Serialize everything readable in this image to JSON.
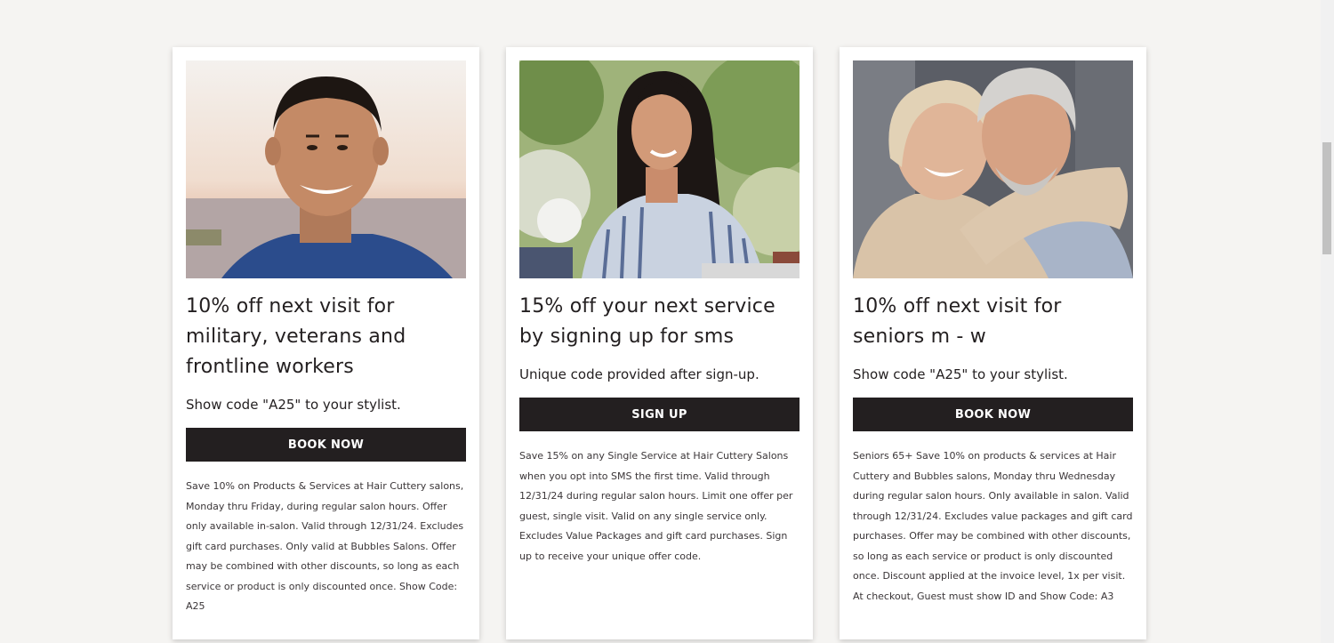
{
  "cards": [
    {
      "image_alt": "Smiling man in blue t-shirt outdoors at sunset",
      "title": "10% off next visit for military, veterans and frontline workers",
      "subtitle": "Show code \"A25\" to your stylist.",
      "button_label": "BOOK NOW",
      "fine_print": "Save 10% on Products & Services at Hair Cuttery salons, Monday thru Friday, during regular salon hours. Offer only available in-salon. Valid through 12/31/24. Excludes gift card purchases. Only valid at Bubbles Salons. Offer may be combined with other discounts, so long as each service or product is only discounted once. Show Code: A25"
    },
    {
      "image_alt": "Smiling woman with long dark hair in striped shirt outdoors",
      "title": "15% off your next service by signing up for sms",
      "subtitle": "Unique code provided after sign-up.",
      "button_label": "SIGN UP",
      "fine_print": "Save 15% on any Single Service at Hair Cuttery Salons when you opt into SMS the first time. Valid through 12/31/24 during regular salon hours. Limit one offer per guest, single visit. Valid on any single service only. Excludes Value Packages and gift card purchases. Sign up to receive your unique offer code."
    },
    {
      "image_alt": "Laughing senior couple embracing",
      "title": "10% off next visit for seniors m - w",
      "subtitle": "Show code \"A25\" to your stylist.",
      "button_label": "BOOK NOW",
      "fine_print": "Seniors 65+ Save 10% on products & services at Hair Cuttery and Bubbles salons, Monday thru Wednesday during regular salon hours. Only available in salon. Valid through 12/31/24. Excludes value packages and gift card purchases. Offer may be combined with other discounts, so long as each service or product is only discounted once. Discount applied at the invoice level, 1x per visit. At checkout, Guest must show ID and Show Code: A3"
    }
  ],
  "colors": {
    "page_background": "#f5f4f2",
    "card_background": "#ffffff",
    "button_background": "#231f20",
    "button_text": "#ffffff",
    "text": "#231f20"
  }
}
